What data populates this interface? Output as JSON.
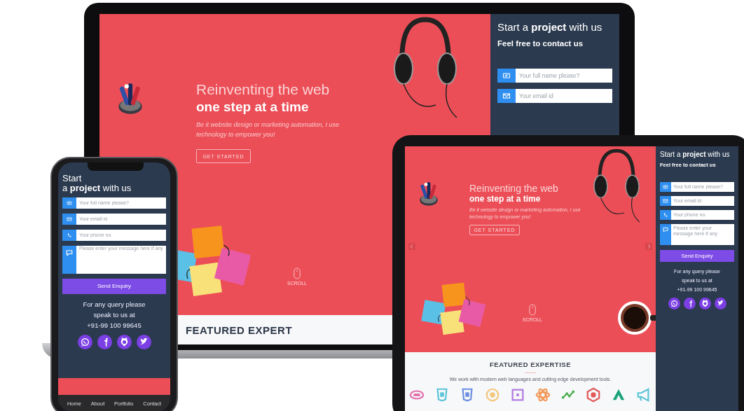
{
  "laptop": {
    "hero": {
      "title": "Reinventing the web",
      "subtitle": "one step at a time",
      "description": "Be it website design or marketing automation, I use technology to empower you!",
      "button": "GET STARTED",
      "scroll": "SCROLL"
    },
    "contact": {
      "title": "Start a **project** with us",
      "subtitle": "Feel free to contact us",
      "fields": [
        {
          "kind": "name",
          "placeholder": "Your full name please?"
        },
        {
          "kind": "email",
          "placeholder": "Your email id"
        }
      ]
    },
    "features": {
      "title": "FEATURED EXPERT"
    }
  },
  "tablet": {
    "hero": {
      "title": "Reinventing the web",
      "subtitle": "one step at a time",
      "description": "Be it website design or marketing automation, I use technology to empower you!",
      "button": "GET STARTED",
      "scroll": "SCROLL"
    },
    "contact": {
      "title": "Start a **project** with us",
      "subtitle": "Feel free to contact us",
      "fields": [
        {
          "kind": "name",
          "placeholder": "Your full name please?"
        },
        {
          "kind": "email",
          "placeholder": "Your email id"
        },
        {
          "kind": "phone",
          "placeholder": "Your phone no."
        },
        {
          "kind": "message",
          "placeholder": "Please enter your message here if any"
        }
      ],
      "button": "Send Enquiry",
      "info_lines": [
        "For any query please",
        "speak to us at",
        "+91-99 100 99645"
      ],
      "socials": [
        {
          "kind": "whatsapp"
        },
        {
          "kind": "facebook"
        },
        {
          "kind": "github"
        },
        {
          "kind": "twitter"
        }
      ]
    },
    "features": {
      "title": "FEATURED EXPERTISE",
      "description": "We work with modern web languages and cutting edge development tools.",
      "tech_icons": [
        {
          "kind": "ellipse",
          "color": "#e06aa8"
        },
        {
          "kind": "shield",
          "color": "#5bc4d6"
        },
        {
          "kind": "shield",
          "color": "#6b8fe0"
        },
        {
          "kind": "circle",
          "color": "#f2c77a"
        },
        {
          "kind": "square",
          "color": "#b07ae0"
        },
        {
          "kind": "atom",
          "color": "#f29a5a"
        },
        {
          "kind": "nodes",
          "color": "#4caf50"
        },
        {
          "kind": "hexagon",
          "color": "#e05a5a"
        },
        {
          "kind": "triangle",
          "color": "#1aa37a"
        },
        {
          "kind": "megaphone",
          "color": "#5bc4d6"
        }
      ]
    }
  },
  "phone": {
    "contact": {
      "title_lines": [
        "Start",
        "a **project** with us"
      ],
      "fields": [
        {
          "kind": "name",
          "placeholder": "Your full name please?"
        },
        {
          "kind": "email",
          "placeholder": "Your email id"
        },
        {
          "kind": "phone",
          "placeholder": "Your phone no."
        },
        {
          "kind": "message",
          "placeholder": "Please enter your message here if any"
        }
      ],
      "button": "Send Enquiry",
      "info_lines": [
        "For any query please",
        "speak to us at",
        "+91-99 100 99645"
      ],
      "socials": [
        {
          "kind": "whatsapp"
        },
        {
          "kind": "facebook"
        },
        {
          "kind": "github"
        },
        {
          "kind": "twitter"
        }
      ]
    },
    "nav": [
      {
        "label": "Home"
      },
      {
        "label": "About"
      },
      {
        "label": "Portfolio"
      },
      {
        "label": "Contact"
      }
    ]
  }
}
